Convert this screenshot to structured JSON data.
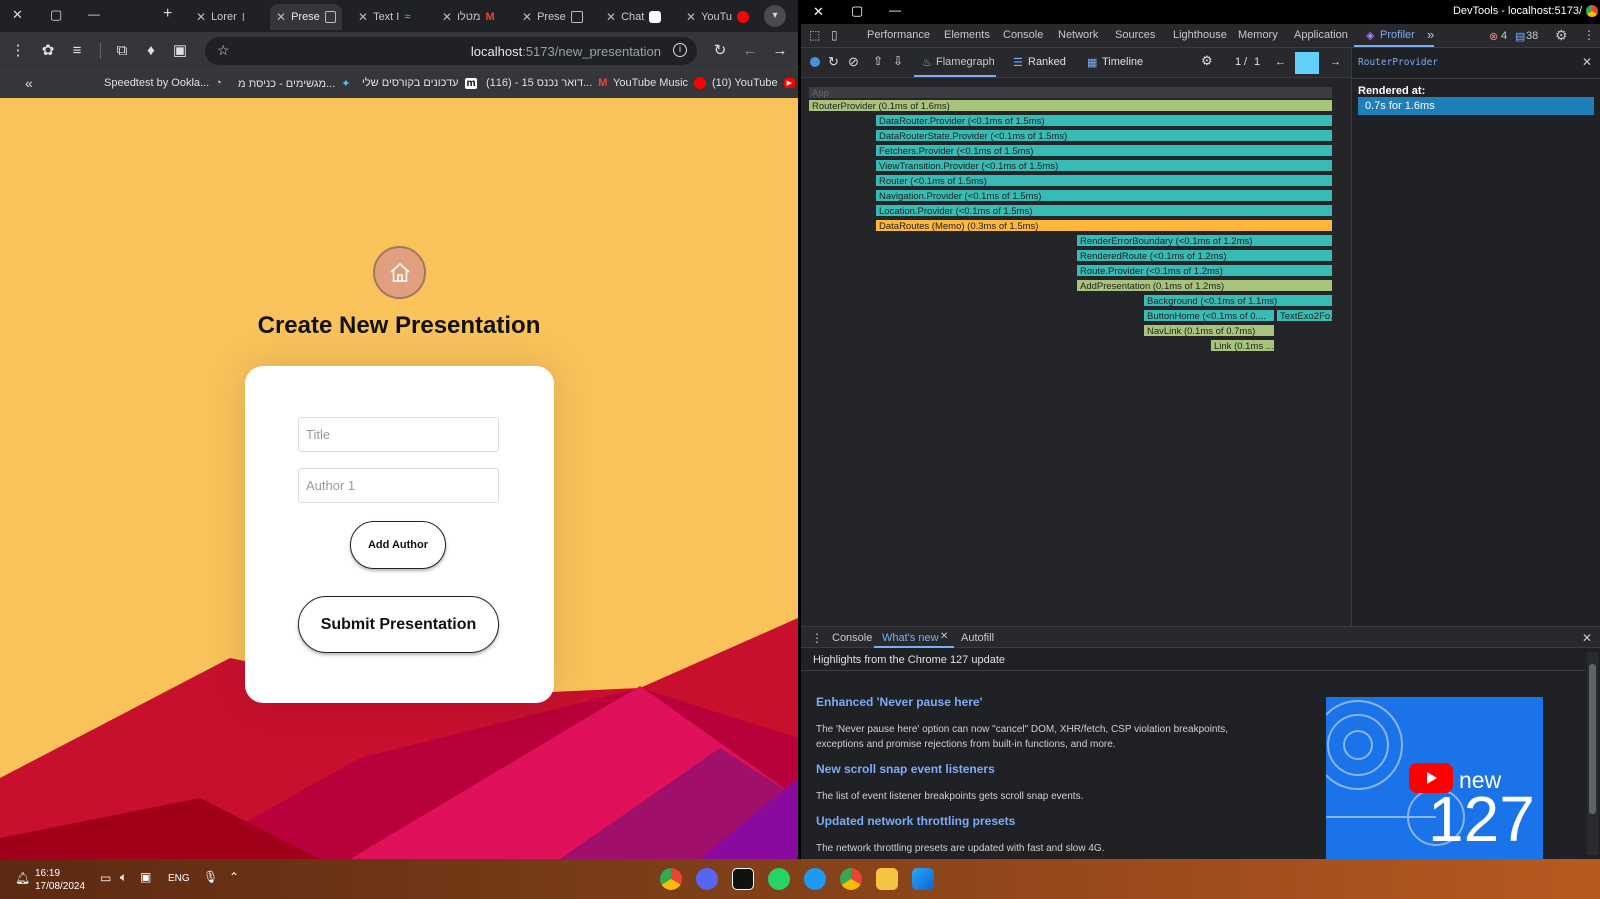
{
  "browser": {
    "window_controls": {
      "close": "✕",
      "restore": "▢",
      "minimize": "—"
    },
    "new_tab": "+",
    "tabs": [
      {
        "label": "Lorer",
        "active": false
      },
      {
        "label": "Prese",
        "active": true
      },
      {
        "label": "Text I",
        "active": false
      },
      {
        "label": "מטלו",
        "active": false
      },
      {
        "label": "Prese",
        "active": false
      },
      {
        "label": "Chat",
        "active": false
      },
      {
        "label": "YouTu",
        "active": false
      }
    ],
    "address": {
      "host": "localhost",
      "path": ":5173/new_presentation"
    },
    "bookmarks": [
      {
        "label": "Speedtest by Ookla..."
      },
      {
        "label": "מגשימים - כניסת מ..."
      },
      {
        "label": "עדכונים בקורסים שלי"
      },
      {
        "label": "(116) - דואר נכנס 15..."
      },
      {
        "label": "YouTube Music"
      },
      {
        "label": "(10) YouTube"
      }
    ],
    "bookmarks_toggle": "«"
  },
  "page": {
    "title": "Create New Presentation",
    "title_placeholder": "Title",
    "author_placeholder": "Author 1",
    "add_author_label": "Add Author",
    "submit_label": "Submit Presentation"
  },
  "devtools": {
    "window_title": "DevTools - localhost:5173/",
    "tabs": [
      "Performance",
      "Elements",
      "Console",
      "Network",
      "Sources",
      "Lighthouse",
      "Memory",
      "Application",
      "Profiler"
    ],
    "active_tab": "Profiler",
    "more_tabs": "»",
    "error_count": "4",
    "message_count": "38",
    "profiler_views": [
      "Flamegraph",
      "Ranked",
      "Timeline"
    ],
    "commit_index": "1",
    "commit_separator": "/",
    "commit_total": "1",
    "flamegraph": [
      {
        "label": "App",
        "kind": "gray"
      },
      {
        "label": "RouterProvider (0.1ms of 1.6ms)",
        "kind": "olive"
      },
      {
        "label": "DataRouter.Provider (<0.1ms of 1.5ms)",
        "kind": "teal"
      },
      {
        "label": "DataRouterState.Provider (<0.1ms of 1.5ms)",
        "kind": "teal"
      },
      {
        "label": "Fetchers.Provider (<0.1ms of 1.5ms)",
        "kind": "teal"
      },
      {
        "label": "ViewTransition.Provider (<0.1ms of 1.5ms)",
        "kind": "teal"
      },
      {
        "label": "Router (<0.1ms of 1.5ms)",
        "kind": "teal"
      },
      {
        "label": "Navigation.Provider (<0.1ms of 1.5ms)",
        "kind": "teal"
      },
      {
        "label": "Location.Provider (<0.1ms of 1.5ms)",
        "kind": "teal"
      },
      {
        "label": "DataRoutes (Memo) (0.3ms of 1.5ms)",
        "kind": "orange"
      },
      {
        "label": "RenderErrorBoundary (<0.1ms of 1.2ms)",
        "kind": "teal"
      },
      {
        "label": "RenderedRoute (<0.1ms of 1.2ms)",
        "kind": "teal"
      },
      {
        "label": "Route.Provider (<0.1ms of 1.2ms)",
        "kind": "teal"
      },
      {
        "label": "AddPresentation (0.1ms of 1.2ms)",
        "kind": "olive"
      },
      {
        "label": "Background (<0.1ms of 1.1ms)",
        "kind": "teal"
      },
      {
        "label": "ButtonHome (<0.1ms of 0....",
        "kind": "teal"
      },
      {
        "label": "TextExo2Fo...",
        "kind": "teal"
      },
      {
        "label": "NavLink (0.1ms of 0.7ms)",
        "kind": "olive"
      },
      {
        "label": "Link (0.1ms ...",
        "kind": "olive"
      }
    ],
    "sidebar": {
      "component": "RouterProvider",
      "rendered_at_label": "Rendered at:",
      "rendered_at_value": "0.7s for 1.6ms"
    },
    "drawer_tabs": [
      "Console",
      "What's new",
      "Autofill"
    ],
    "drawer_active": "What's new",
    "drawer_heading": "Highlights from the Chrome 127 update",
    "highlights": [
      {
        "title": "Enhanced 'Never pause here'",
        "text": "The 'Never pause here' option can now \"cancel\" DOM, XHR/fetch, CSP violation breakpoints, exceptions and promise rejections from built-in functions, and more."
      },
      {
        "title": "New scroll snap event listeners",
        "text": "The list of event listener breakpoints gets scroll snap events."
      },
      {
        "title": "Updated network throttling presets",
        "text": "The network throttling presets are updated with fast and slow 4G."
      }
    ],
    "promo": {
      "word": "new",
      "version": "127"
    }
  },
  "taskbar": {
    "time": "16:19",
    "date": "17/08/2024",
    "language": "ENG"
  }
}
